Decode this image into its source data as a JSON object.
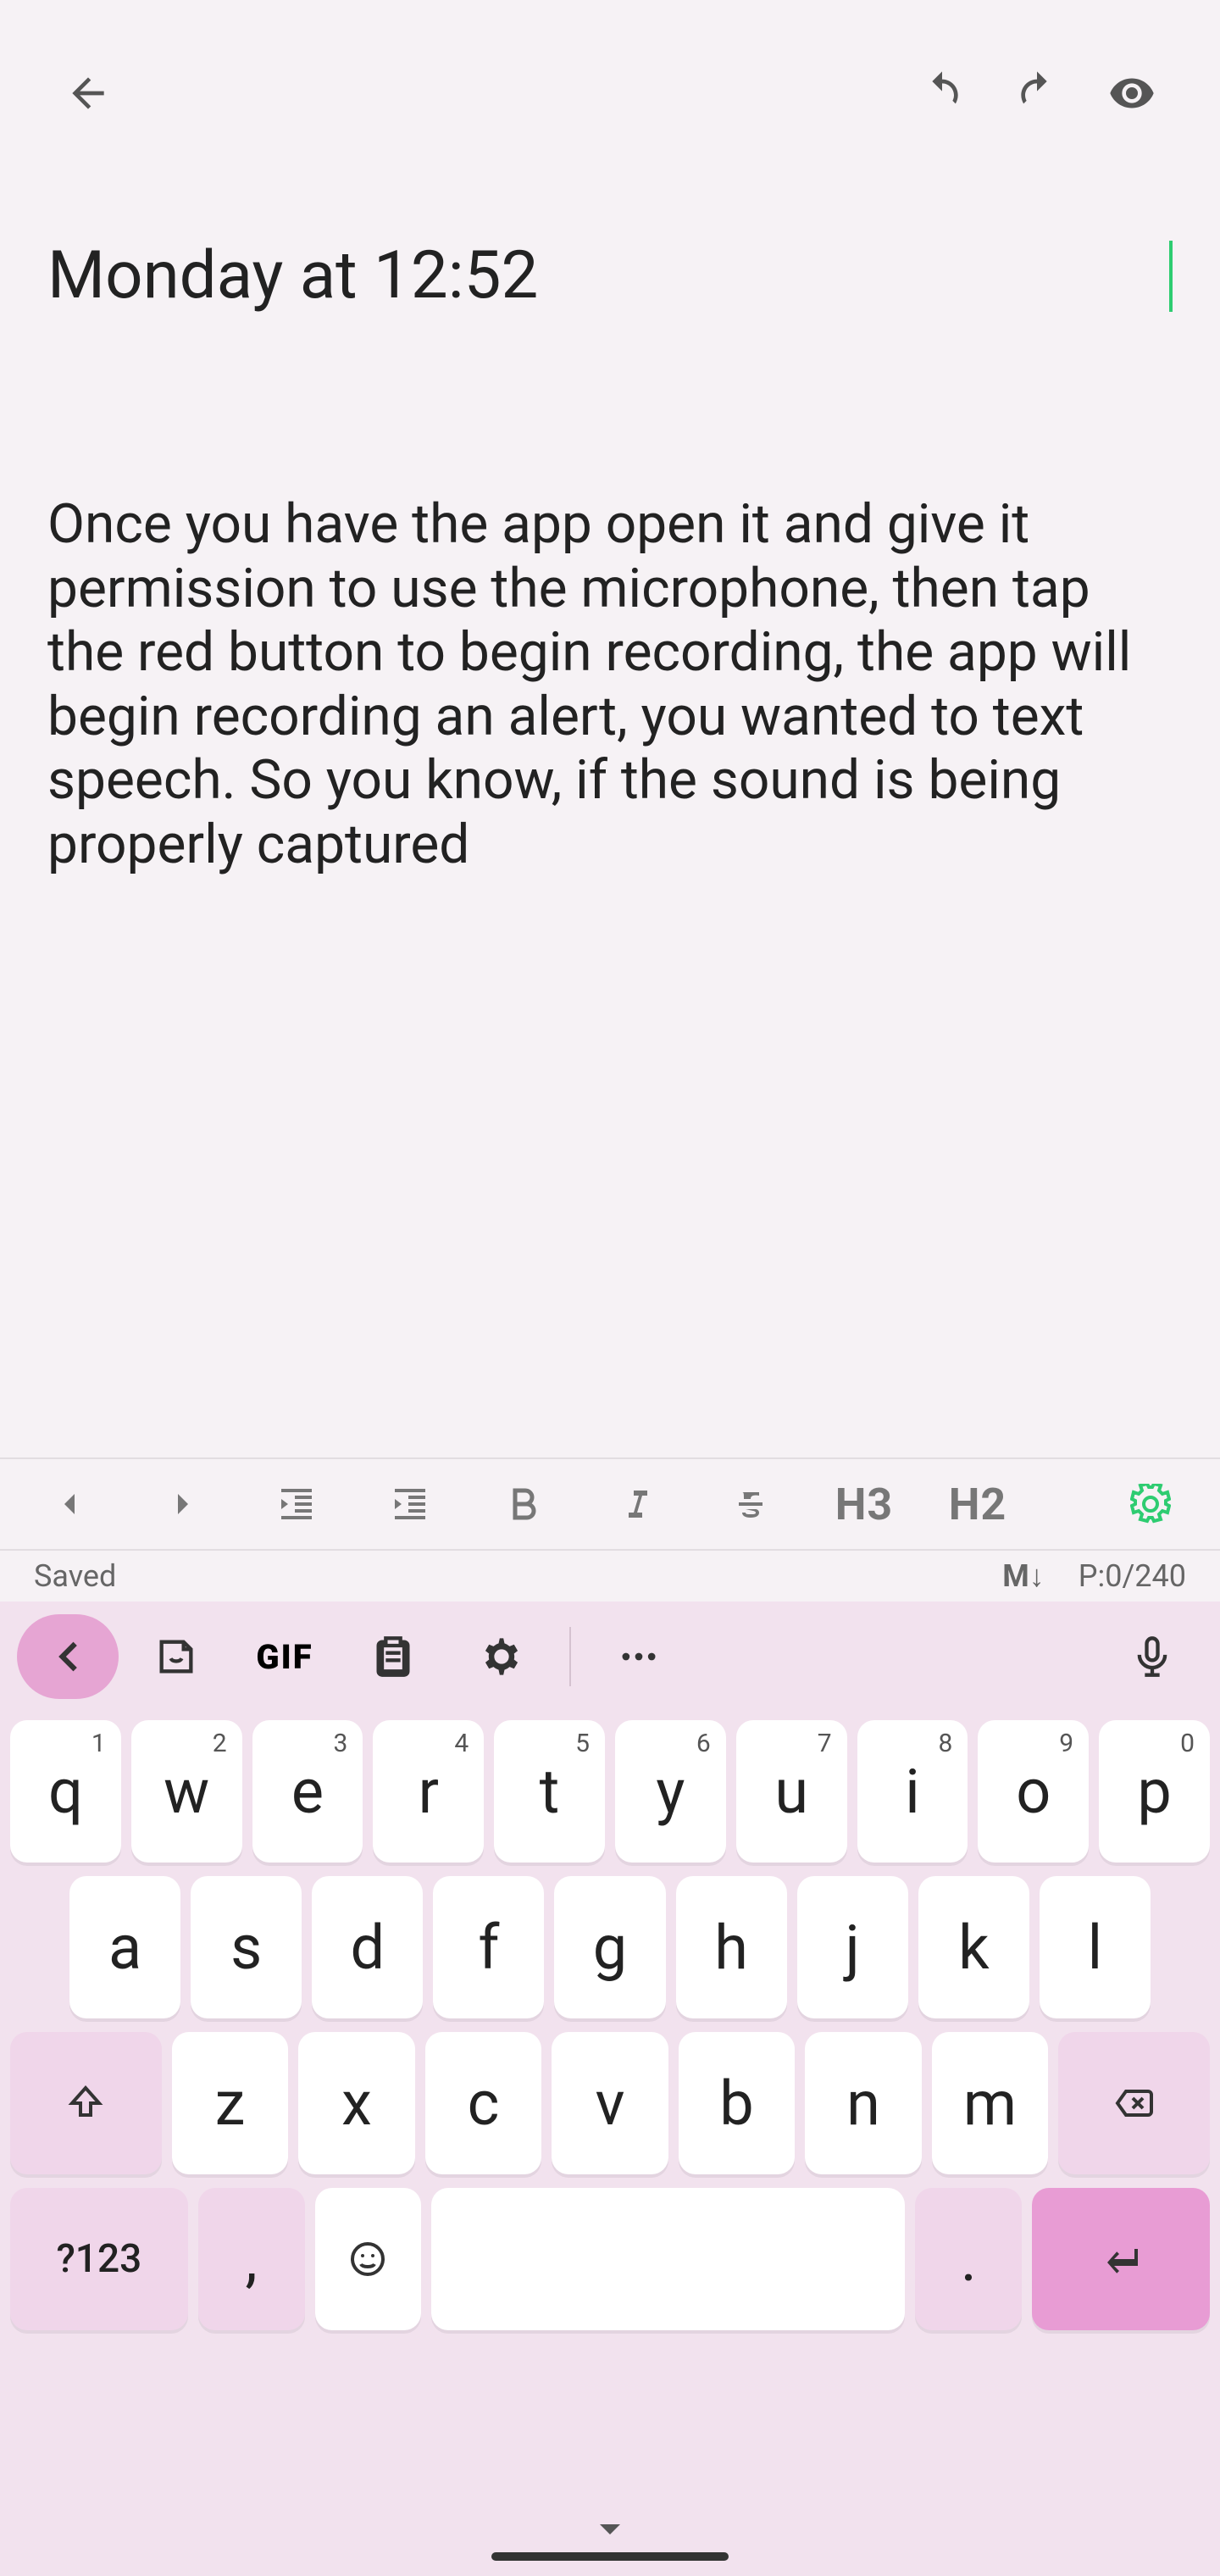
{
  "title": "Monday at 12:52",
  "body": "Once you have the app open it and give it permission to use the microphone, then tap the red button to begin recording, the app will begin recording an alert, you wanted to text speech. So you know, if the sound is being properly captured",
  "status": {
    "saved": "Saved",
    "markdown": "M↓",
    "position": "P:0/240"
  },
  "fmt": {
    "h3": "H3",
    "h2": "H2"
  },
  "keyboard": {
    "gif": "GIF",
    "sym123": "?123",
    "comma": ",",
    "period": ".",
    "row1": [
      {
        "k": "q",
        "n": "1"
      },
      {
        "k": "w",
        "n": "2"
      },
      {
        "k": "e",
        "n": "3"
      },
      {
        "k": "r",
        "n": "4"
      },
      {
        "k": "t",
        "n": "5"
      },
      {
        "k": "y",
        "n": "6"
      },
      {
        "k": "u",
        "n": "7"
      },
      {
        "k": "i",
        "n": "8"
      },
      {
        "k": "o",
        "n": "9"
      },
      {
        "k": "p",
        "n": "0"
      }
    ],
    "row2": [
      "a",
      "s",
      "d",
      "f",
      "g",
      "h",
      "j",
      "k",
      "l"
    ],
    "row3": [
      "z",
      "x",
      "c",
      "v",
      "b",
      "n",
      "m"
    ]
  }
}
